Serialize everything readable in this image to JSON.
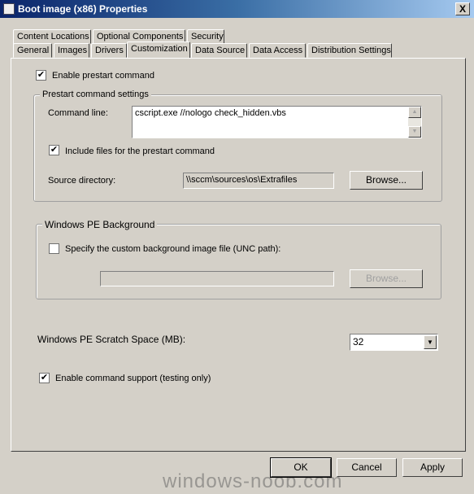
{
  "window": {
    "title": "Boot image (x86) Properties",
    "close": "X"
  },
  "tabs_row1": [
    "Content Locations",
    "Optional Components",
    "Security"
  ],
  "tabs_row2": [
    "General",
    "Images",
    "Drivers",
    "Customization",
    "Data Source",
    "Data Access",
    "Distribution Settings"
  ],
  "active_tab": "Customization",
  "enable_prestart": {
    "label": "Enable prestart command",
    "checked": true
  },
  "prestart_group": {
    "title": "Prestart command settings",
    "command_label": "Command line:",
    "command_value": "cscript.exe //nologo check_hidden.vbs",
    "include_files": {
      "label": "Include files for the prestart command",
      "checked": true
    },
    "source_label": "Source directory:",
    "source_value": "\\\\sccm\\sources\\os\\Extrafiles",
    "browse": "Browse..."
  },
  "pe_background": {
    "title": "Windows PE Background",
    "specify": {
      "label": "Specify the custom background image file (UNC path):",
      "checked": false
    },
    "path_value": "",
    "browse": "Browse..."
  },
  "scratch": {
    "label": "Windows PE Scratch Space (MB):",
    "value": "32"
  },
  "command_support": {
    "label": "Enable command support (testing only)",
    "checked": true
  },
  "buttons": {
    "ok": "OK",
    "cancel": "Cancel",
    "apply": "Apply"
  },
  "watermark": "windows-noob.com"
}
